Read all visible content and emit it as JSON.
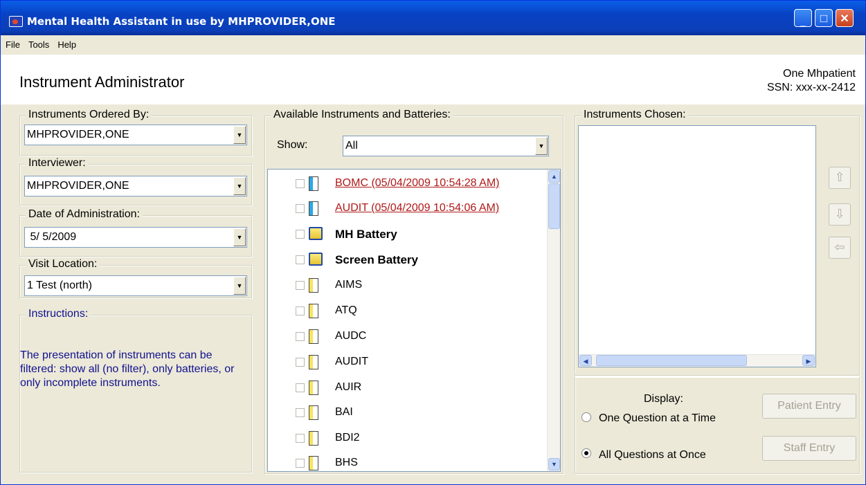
{
  "window": {
    "title": "Mental Health Assistant in use by MHPROVIDER,ONE",
    "minimize": "_",
    "maximize": "□",
    "close": "✕"
  },
  "menu": [
    "File",
    "Tools",
    "Help"
  ],
  "header": {
    "title": "Instrument Administrator",
    "patient_name": "One Mhpatient",
    "patient_ssn": "SSN: xxx-xx-2412"
  },
  "left": {
    "ordered_by_label": "Instruments Ordered By:",
    "ordered_by_value": "MHPROVIDER,ONE",
    "interviewer_label": "Interviewer:",
    "interviewer_value": "MHPROVIDER,ONE",
    "date_label": "Date of Administration:",
    "date_value": " 5/ 5/2009",
    "location_label": "Visit Location:",
    "location_value": "1 Test (north)",
    "instructions_label": "Instructions:",
    "instructions_text": " The presentation of instruments can be filtered: show all (no filter), only batteries, or only incomplete instruments."
  },
  "available": {
    "label": "Available Instruments and Batteries:",
    "show_label": "Show:",
    "show_value": "All",
    "items": [
      {
        "label": "BOMC  (05/04/2009 10:54:28 AM)",
        "kind": "incomplete"
      },
      {
        "label": "AUDIT  (05/04/2009 10:54:06 AM)",
        "kind": "incomplete"
      },
      {
        "label": "MH Battery",
        "kind": "battery"
      },
      {
        "label": "Screen Battery",
        "kind": "battery"
      },
      {
        "label": "AIMS",
        "kind": "instrument"
      },
      {
        "label": "ATQ",
        "kind": "instrument"
      },
      {
        "label": "AUDC",
        "kind": "instrument"
      },
      {
        "label": "AUDIT",
        "kind": "instrument"
      },
      {
        "label": "AUIR",
        "kind": "instrument"
      },
      {
        "label": "BAI",
        "kind": "instrument"
      },
      {
        "label": "BDI2",
        "kind": "instrument"
      },
      {
        "label": "BHS",
        "kind": "instrument"
      }
    ]
  },
  "chosen": {
    "label": "Instruments Chosen:",
    "move_up": "⇧",
    "move_down": "⇩",
    "remove": "⇦"
  },
  "display": {
    "label": "Display:",
    "option_one": "One Question at a Time",
    "option_all": "All Questions at Once",
    "selected": "All Questions at Once"
  },
  "buttons": {
    "patient_entry": "Patient Entry",
    "staff_entry": "Staff Entry"
  },
  "colors": {
    "incomplete": "#b01818",
    "instructions": "#11118f",
    "titlebar": "#0842c3"
  }
}
